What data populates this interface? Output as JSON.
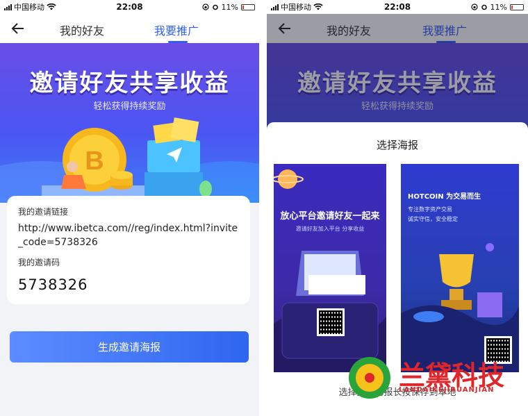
{
  "status": {
    "carrier": "中国移动",
    "time": "22:08",
    "battery": "11%",
    "battery_level": 0.11,
    "signal_icon": "signal-icon",
    "wifi_icon": "wifi-icon",
    "lock_icon": "rotation-lock-icon",
    "alarm_icon": "alarm-icon"
  },
  "nav": {
    "tabs": [
      {
        "label": "我的好友"
      },
      {
        "label": "我要推广"
      }
    ],
    "back_icon": "back-arrow-icon"
  },
  "banner": {
    "title": "邀请好友共享收益",
    "subtitle": "轻松获得持续奖励"
  },
  "invite_card": {
    "link_label": "我的邀请链接",
    "link_value": "http://www.ibetca.com//reg/index.html?invite_code=5738326",
    "code_label": "我的邀请码",
    "code_value": "5738326"
  },
  "generate_button": {
    "label": "生成邀请海报"
  },
  "poster_sheet": {
    "title": "选择海报",
    "hint": "选择推广海报长按保存到本地",
    "posters": [
      {
        "headline": "放心平台邀请好友一起来",
        "sub": "邀请好友加入平台 分享收益"
      },
      {
        "brand": "HOTCOIN 为交易而生",
        "sub1": "专注数字资产交易",
        "sub2": "诚实守信，安全稳定"
      }
    ]
  },
  "watermark": {
    "text": "兰黛科技",
    "sub": "LANDAIKEJIRUANJIAN"
  },
  "colors": {
    "accent": "#2f5ff5",
    "banner_top": "#6a4ee6",
    "banner_bottom": "#3f7df5",
    "watermark_red": "#e0262a"
  }
}
